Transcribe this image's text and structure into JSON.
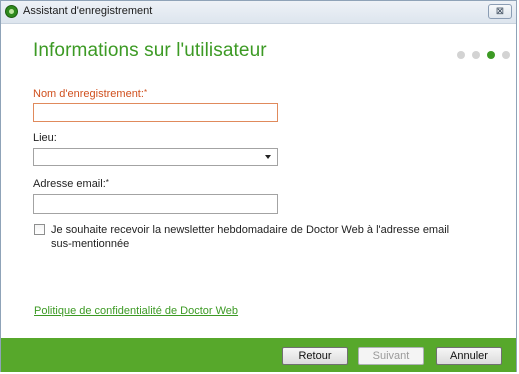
{
  "window": {
    "title": "Assistant d'enregistrement",
    "close_glyph": "⊠"
  },
  "page": {
    "heading": "Informations sur l'utilisateur",
    "steps_total": 4,
    "step_active": 3
  },
  "form": {
    "registration_name": {
      "label": "Nom d'enregistrement:",
      "required_mark": "*",
      "value": ""
    },
    "location": {
      "label": "Lieu:",
      "selected": ""
    },
    "email": {
      "label": "Adresse email:",
      "required_mark": "*",
      "value": ""
    },
    "newsletter": {
      "label": "Je souhaite recevoir la newsletter hebdomadaire de Doctor Web à l'adresse email sus-mentionnée",
      "checked": false
    }
  },
  "privacy_link": "Politique de confidentialité de Doctor Web",
  "buttons": {
    "back": "Retour",
    "next": "Suivant",
    "cancel": "Annuler"
  },
  "colors": {
    "accent": "#3c9a24",
    "required": "#d0501e",
    "footer": "#57a82b"
  }
}
